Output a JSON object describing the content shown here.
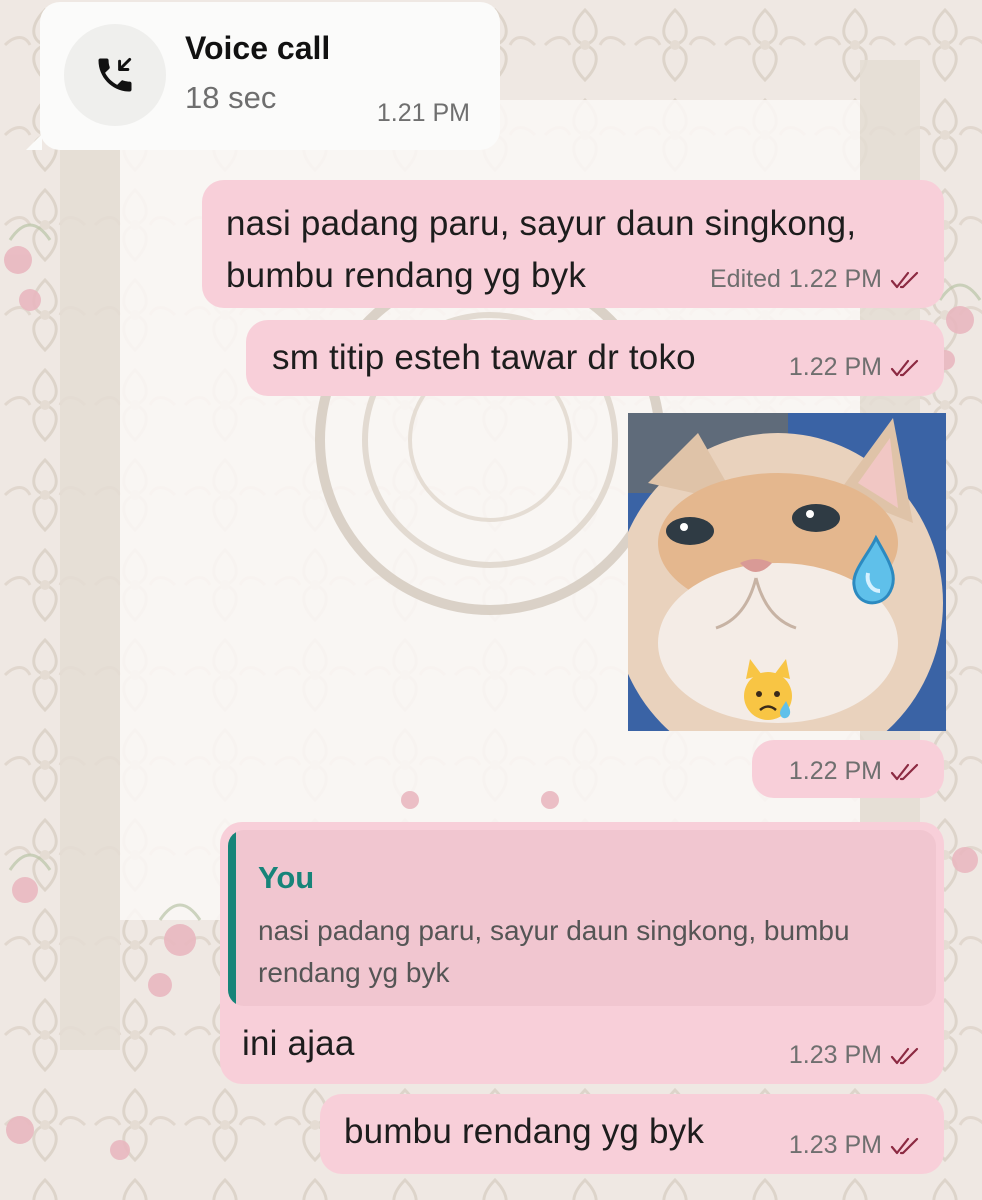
{
  "call": {
    "title": "Voice call",
    "duration": "18 sec",
    "time": "1.21 PM",
    "icon": "incoming-call-icon"
  },
  "messages": [
    {
      "id": "m1",
      "text": "nasi padang paru, sayur daun singkong, bumbu rendang yg byk",
      "edited": "Edited",
      "time": "1.22 PM",
      "status": "read"
    },
    {
      "id": "m2",
      "text": "sm titip esteh tawar dr toko",
      "time": "1.22 PM",
      "status": "read"
    },
    {
      "id": "m3",
      "type": "sticker",
      "emoji": "😿",
      "time": "1.22 PM",
      "status": "read"
    },
    {
      "id": "m4",
      "reply": {
        "author": "You",
        "text": "nasi padang paru, sayur daun singkong, bumbu rendang yg byk"
      },
      "text": "ini ajaa",
      "time": "1.23 PM",
      "status": "read"
    },
    {
      "id": "m5",
      "text": "bumbu rendang yg byk",
      "time": "1.23 PM",
      "status": "read"
    }
  ],
  "colors": {
    "outgoing_bubble": "#f8cfd9",
    "incoming_bubble": "#fbfbfa",
    "reply_accent": "#178479",
    "read_ticks": "#8c2a42",
    "wallpaper": "#efe8e3"
  }
}
